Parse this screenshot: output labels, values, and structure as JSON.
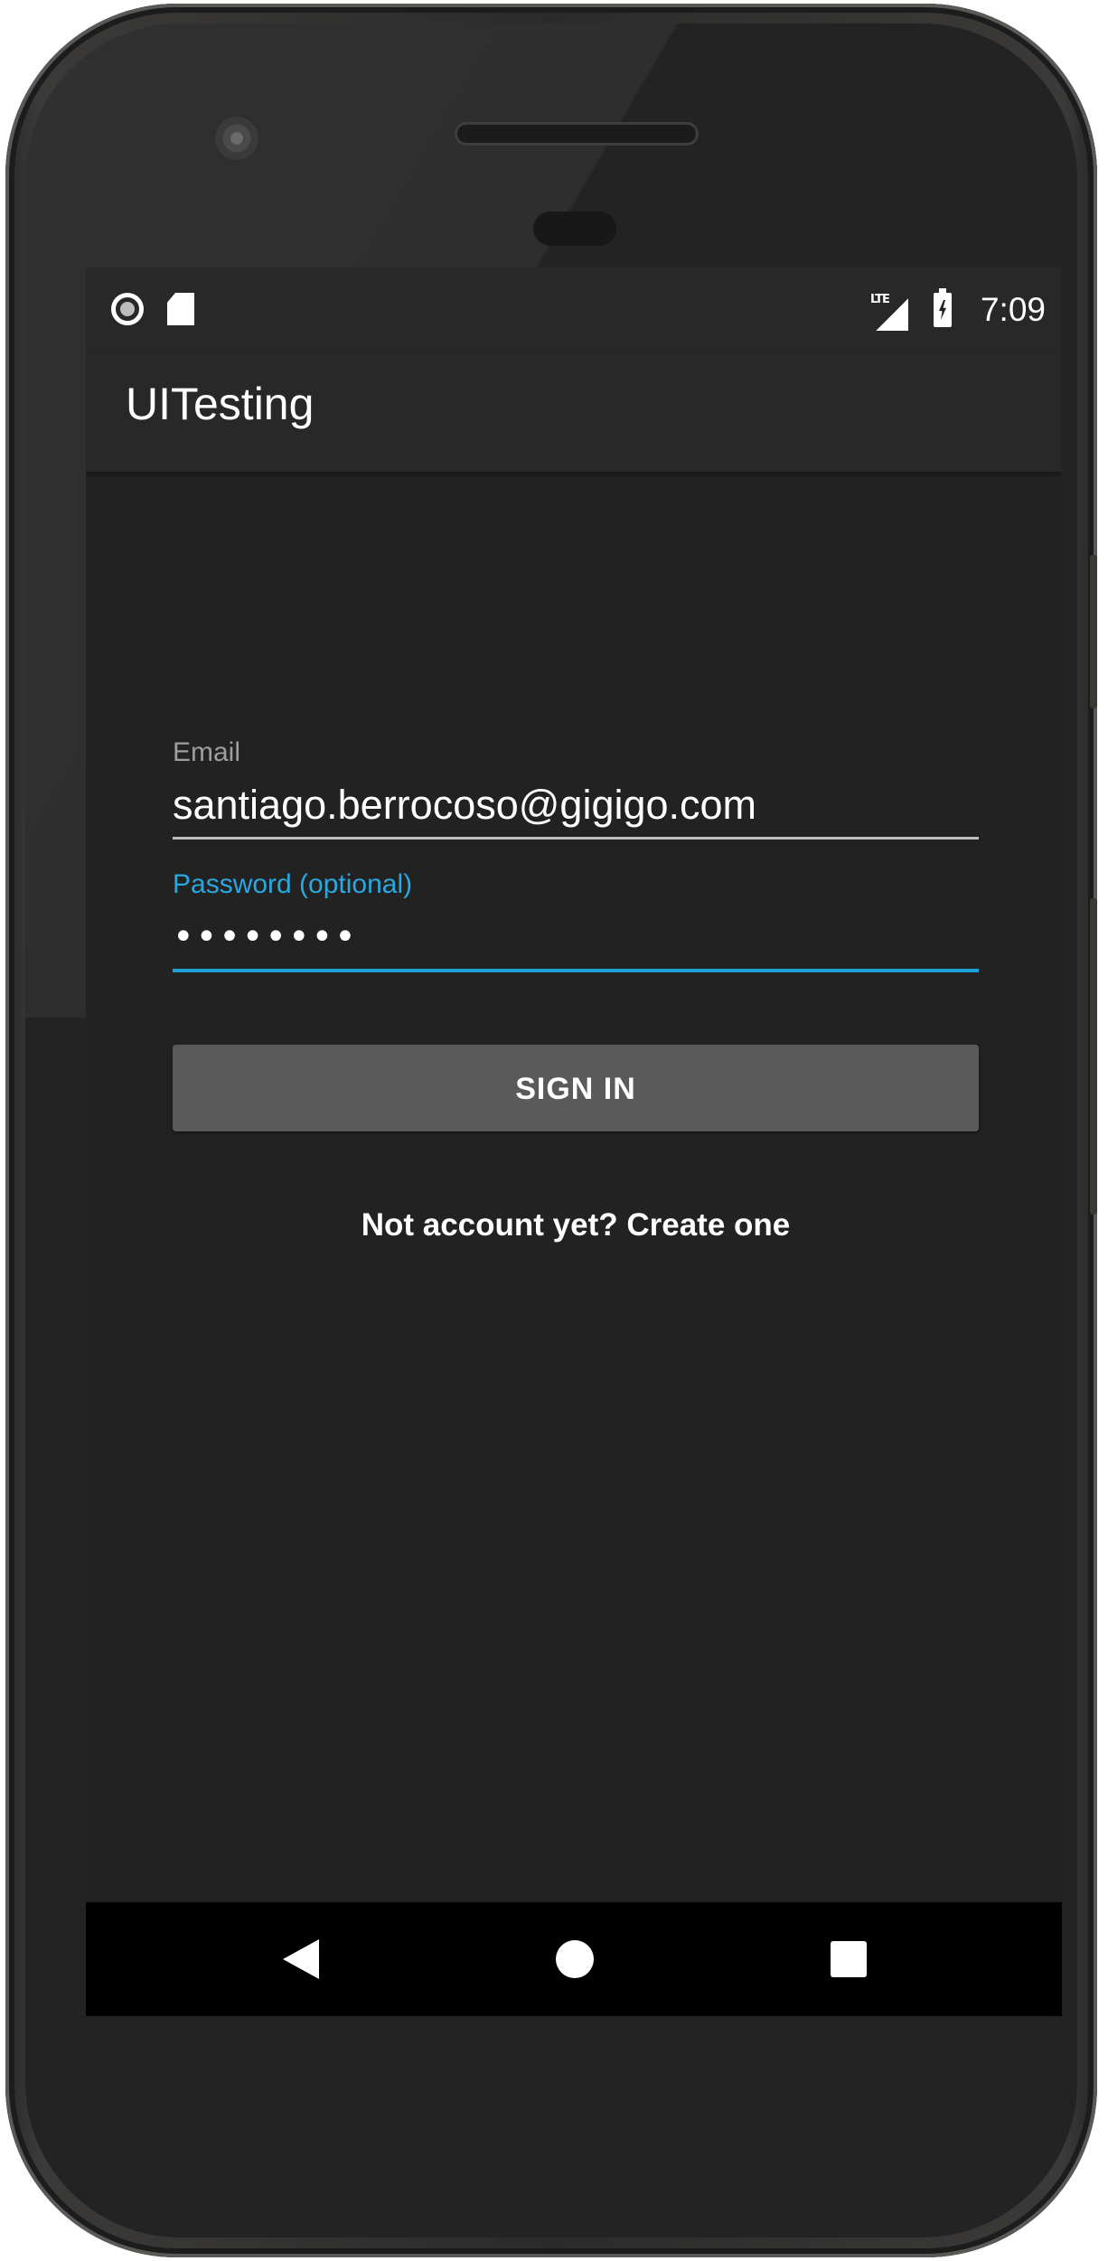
{
  "status_bar": {
    "time": "7:09",
    "network_type": "LTE",
    "icons": [
      "record-icon",
      "sd-card-icon",
      "lte-signal-icon",
      "battery-charging-icon"
    ]
  },
  "app_bar": {
    "title": "UITesting"
  },
  "form": {
    "email_label": "Email",
    "email_value": "santiago.berrocoso@gigigo.com",
    "password_label": "Password (optional)",
    "password_value": "••••••••",
    "sign_in_label": "SIGN IN",
    "create_account_text": "Not account yet? Create one"
  },
  "colors": {
    "background": "#222222",
    "accent": "#1ea2da",
    "button": "#5a5a5b"
  },
  "nav_bar": {
    "icons": [
      "back-icon",
      "home-icon",
      "recents-icon"
    ]
  }
}
